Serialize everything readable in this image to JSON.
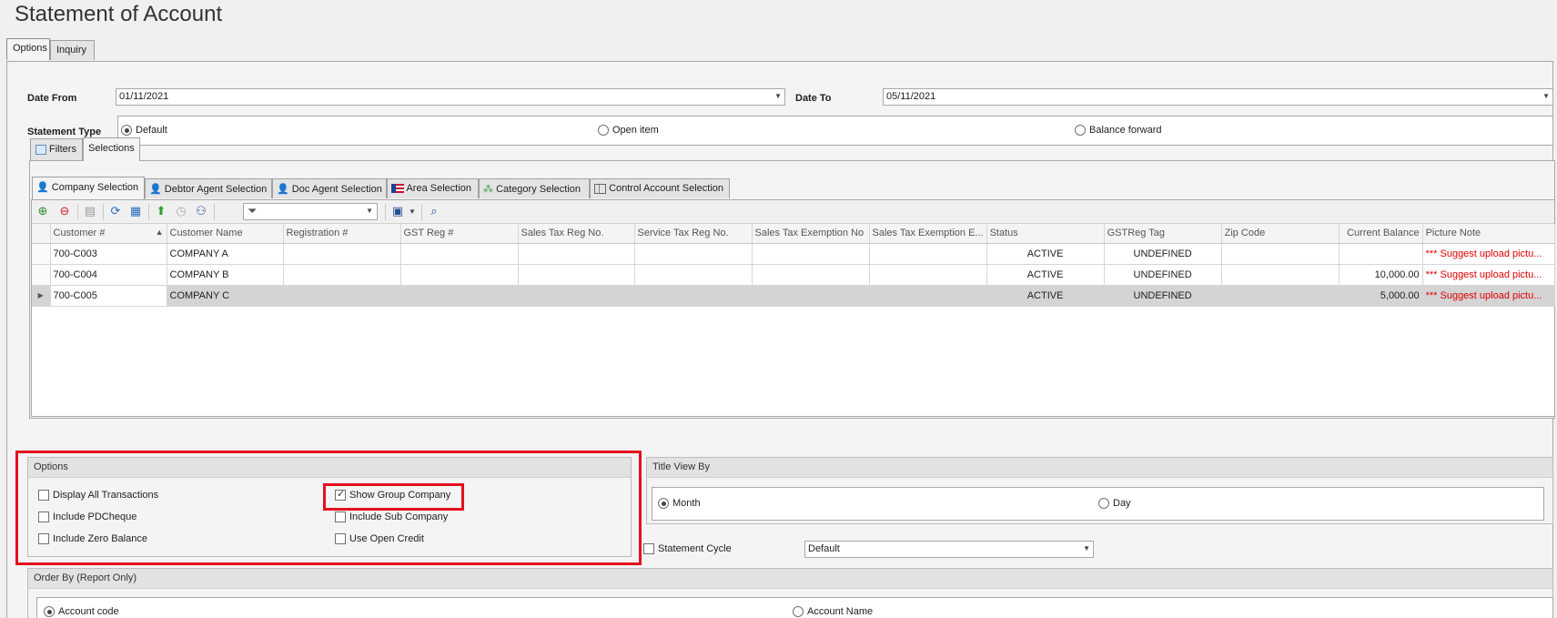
{
  "window": {
    "title": "Statement of Account"
  },
  "top_tabs": [
    {
      "label": "Options",
      "active": true
    },
    {
      "label": "Inquiry",
      "active": false
    }
  ],
  "date_from": {
    "label": "Date From",
    "value": "01/11/2021"
  },
  "date_to": {
    "label": "Date To",
    "value": "05/11/2021"
  },
  "statement_type": {
    "label": "Statement Type",
    "options": [
      {
        "label": "Default",
        "selected": true
      },
      {
        "label": "Open item",
        "selected": false
      },
      {
        "label": "Balance forward",
        "selected": false
      }
    ]
  },
  "mid_tabs": [
    {
      "label": "Filters",
      "icon": "filter-copy-icon",
      "active": false
    },
    {
      "label": "Selections",
      "active": true
    }
  ],
  "selection_tabs": [
    {
      "label": "Company Selection",
      "icon": "person-icon",
      "active": true
    },
    {
      "label": "Debtor Agent Selection",
      "icon": "person-icon",
      "active": false
    },
    {
      "label": "Doc Agent Selection",
      "icon": "person-icon",
      "active": false
    },
    {
      "label": "Area Selection",
      "icon": "flag-icon",
      "active": false
    },
    {
      "label": "Category Selection",
      "icon": "hierarchy-icon",
      "active": false
    },
    {
      "label": "Control Account Selection",
      "icon": "table-icon",
      "active": false
    }
  ],
  "grid": {
    "columns": [
      "Customer #",
      "Customer Name",
      "Registration #",
      "GST Reg #",
      "Sales Tax Reg No.",
      "Service Tax Reg No.",
      "Sales Tax Exemption No",
      "Sales Tax Exemption E...",
      "Status",
      "GSTReg Tag",
      "Zip Code",
      "Current Balance",
      "Picture Note"
    ],
    "rows": [
      {
        "cells": [
          "700-C003",
          "COMPANY A",
          "",
          "",
          "",
          "",
          "",
          "",
          "ACTIVE",
          "UNDEFINED",
          "",
          "",
          "*** Suggest upload pictu..."
        ],
        "selected": false
      },
      {
        "cells": [
          "700-C004",
          "COMPANY B",
          "",
          "",
          "",
          "",
          "",
          "",
          "ACTIVE",
          "UNDEFINED",
          "",
          "10,000.00",
          "*** Suggest upload pictu..."
        ],
        "selected": false
      },
      {
        "cells": [
          "700-C005",
          "COMPANY C",
          "",
          "",
          "",
          "",
          "",
          "",
          "ACTIVE",
          "UNDEFINED",
          "",
          "5,000.00",
          "*** Suggest upload pictu..."
        ],
        "selected": true
      }
    ],
    "sort_indicator": "▲",
    "row_indicator": "▶"
  },
  "options": {
    "header": "Options",
    "items": [
      {
        "label": "Display All Transactions",
        "checked": false
      },
      {
        "label": "Show Group Company",
        "checked": true
      },
      {
        "label": "Include PDCheque",
        "checked": false
      },
      {
        "label": "Include Sub Company",
        "checked": false
      },
      {
        "label": "Include Zero Balance",
        "checked": false
      },
      {
        "label": "Use Open Credit",
        "checked": false
      }
    ]
  },
  "title_view_by": {
    "header": "Title View By",
    "options": [
      {
        "label": "Month",
        "selected": true
      },
      {
        "label": "Day",
        "selected": false
      }
    ]
  },
  "statement_cycle": {
    "label": "Statement Cycle",
    "checked": false,
    "value": "Default"
  },
  "order_by": {
    "header": "Order By (Report Only)",
    "options": [
      {
        "label": "Account code",
        "selected": true
      },
      {
        "label": "Account Name",
        "selected": false
      }
    ]
  },
  "colors": {
    "highlight": "#e3101f",
    "warning_text": "#e00000"
  }
}
